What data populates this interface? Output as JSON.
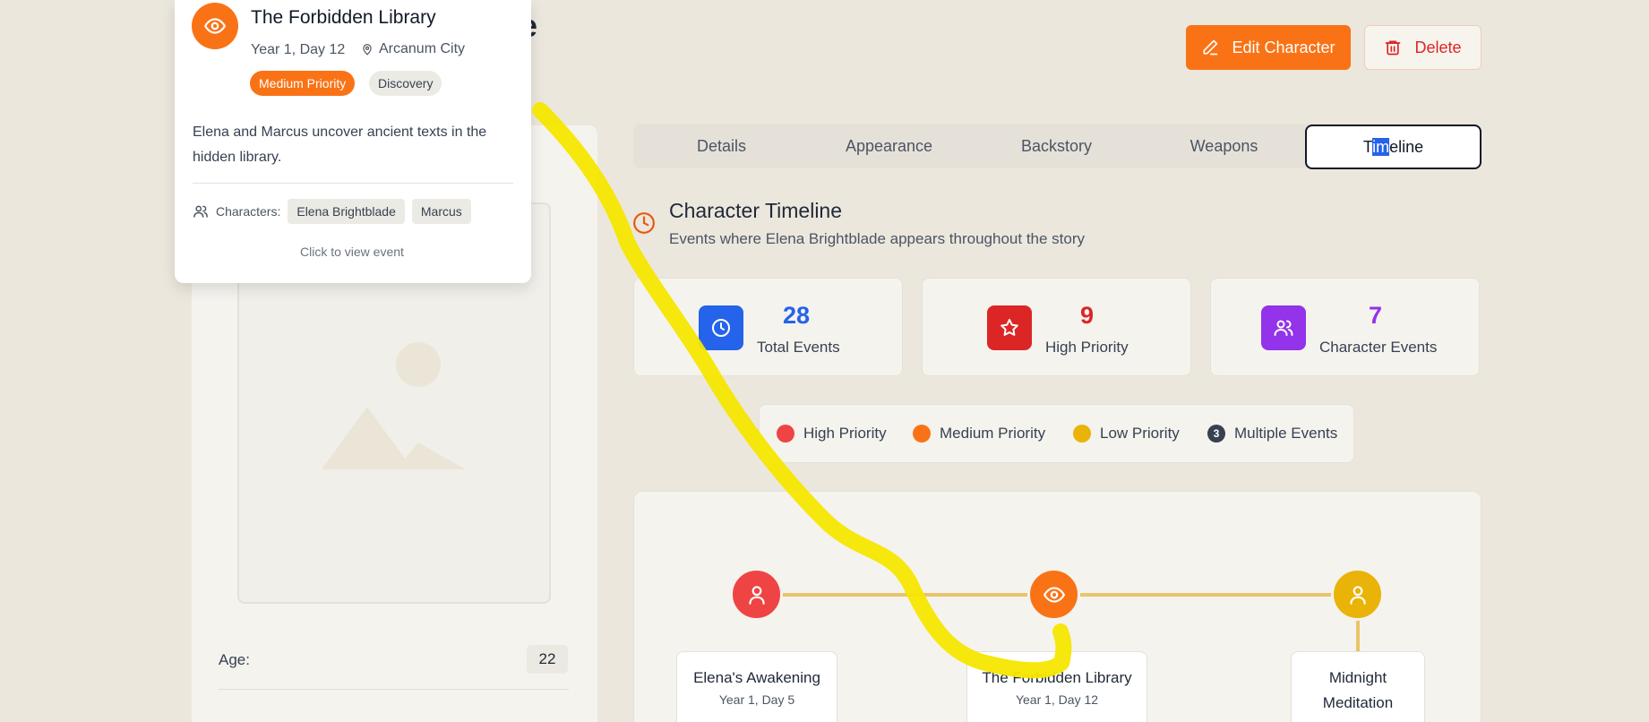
{
  "header": {
    "title_fragment": "de",
    "edit_label": "Edit Character",
    "delete_label": "Delete"
  },
  "tabs": [
    "Details",
    "Appearance",
    "Backstory",
    "Weapons",
    "Timeline"
  ],
  "active_tab": "Timeline",
  "timeline_header": {
    "title": "Character Timeline",
    "subtitle": "Events where Elena Brightblade appears throughout the story"
  },
  "stats": [
    {
      "value": "28",
      "label": "Total Events",
      "icon": "clock-icon",
      "color": "#2563eb"
    },
    {
      "value": "9",
      "label": "High Priority",
      "icon": "star-icon",
      "color": "#dc2626"
    },
    {
      "value": "7",
      "label": "Character Events",
      "icon": "users-icon",
      "color": "#9333ea"
    }
  ],
  "legend": {
    "high": "High Priority",
    "medium": "Medium Priority",
    "low": "Low Priority",
    "multi": "Multiple Events",
    "multi_count": "3",
    "colors": {
      "high": "#ef4444",
      "medium": "#f97316",
      "low": "#eab308",
      "multi": "#374151"
    }
  },
  "events": [
    {
      "title": "Elena's Awakening",
      "date": "Year 1, Day 5",
      "priority": "high",
      "icon": "user-icon"
    },
    {
      "title": "The Forbidden Library",
      "date": "Year 1, Day 12",
      "priority": "medium",
      "icon": "eye-icon"
    },
    {
      "title": "Midnight Meditation",
      "title_line1": "Midnight",
      "title_line2": "Meditation",
      "priority": "low",
      "icon": "user-icon"
    }
  ],
  "left_panel": {
    "age_label": "Age:",
    "age_value": "22"
  },
  "popup": {
    "title": "The Forbidden Library",
    "date": "Year 1, Day 12",
    "location": "Arcanum City",
    "priority_badge": "Medium Priority",
    "type_badge": "Discovery",
    "description": "Elena and Marcus uncover ancient texts in the hidden library.",
    "characters_label": "Characters:",
    "characters": [
      "Elena Brightblade",
      "Marcus"
    ],
    "hint": "Click to view event"
  }
}
